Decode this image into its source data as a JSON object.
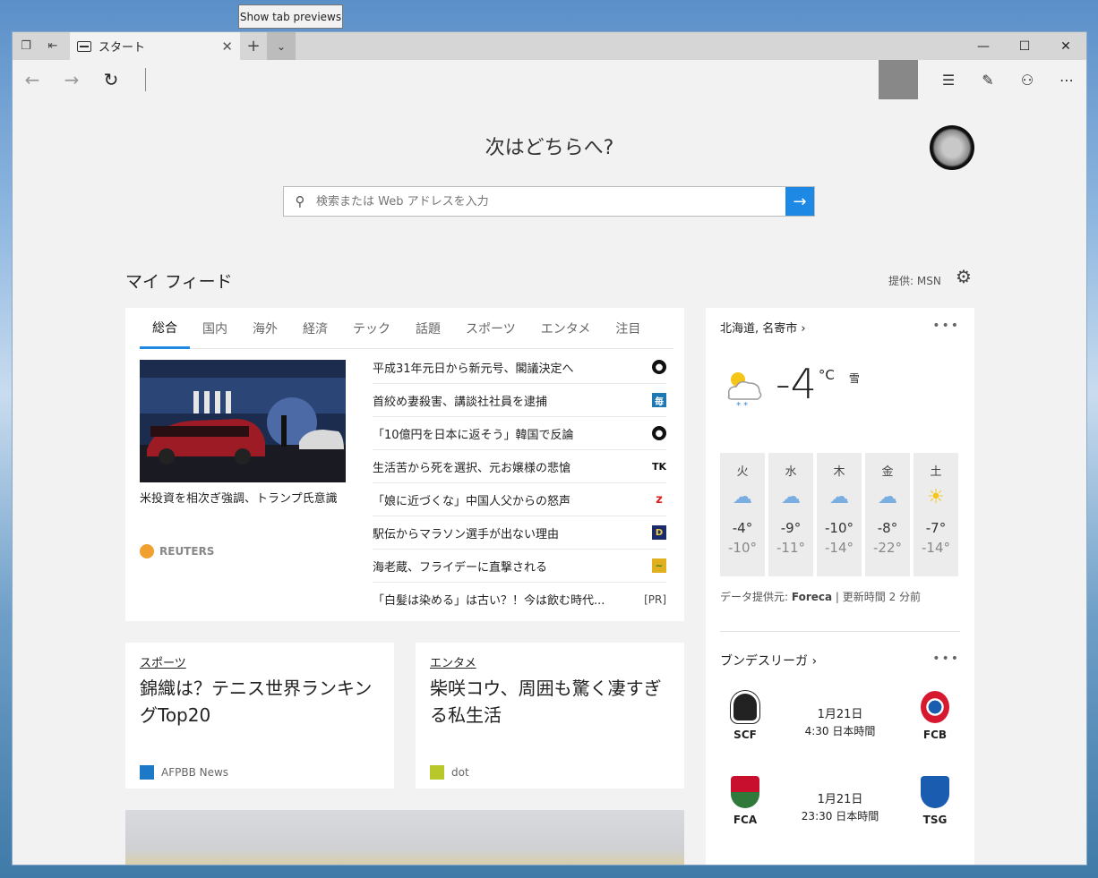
{
  "tooltip": "Show tab previews",
  "tab": {
    "title": "スタート"
  },
  "search": {
    "placeholder": "検索または Web アドレスを入力"
  },
  "heading": "次はどちらへ?",
  "feed": {
    "title": "マイ フィード",
    "provider": "提供: MSN",
    "tabs": [
      "総合",
      "国内",
      "海外",
      "経済",
      "テック",
      "話題",
      "スポーツ",
      "エンタメ",
      "注目"
    ],
    "hero": {
      "caption": "米投資を相次ぎ強調、トランプ氏意識",
      "source": "REUTERS"
    },
    "headlines": [
      {
        "text": "平成31年元日から新元号、閣議決定へ",
        "icon": "tbs-icon"
      },
      {
        "text": "首絞め妻殺害、講談社社員を逮捕",
        "icon": "mainichi-icon"
      },
      {
        "text": "「10億円を日本に返そう」韓国で反論",
        "icon": "tbs-icon"
      },
      {
        "text": "生活苦から死を選択、元お嬢様の悲愴",
        "icon": "tk-icon"
      },
      {
        "text": "「娘に近づくな」中国人父からの怒声",
        "icon": "zakzak-icon"
      },
      {
        "text": "駅伝からマラソン選手が出ない理由",
        "icon": "diamond-icon"
      },
      {
        "text": "海老蔵、フライデーに直撃される",
        "icon": "friday-icon"
      },
      {
        "text": "「白髪は染める」は古い？！今は飲む時代...",
        "badge": "[PR]"
      }
    ],
    "cards": [
      {
        "category": "スポーツ",
        "title": "錦織は？テニス世界ランキングTop20",
        "source": "AFPBB News"
      },
      {
        "category": "エンタメ",
        "title": "柴咲コウ、周囲も驚く凄すぎる私生活",
        "source": "dot"
      }
    ]
  },
  "weather": {
    "location": "北海道, 名寄市",
    "temp": "-4",
    "unit": "°C",
    "condition": "雪",
    "days": [
      {
        "name": "火",
        "hi": "-4°",
        "lo": "-10°",
        "icon": "☁"
      },
      {
        "name": "水",
        "hi": "-9°",
        "lo": "-11°",
        "icon": "☁"
      },
      {
        "name": "木",
        "hi": "-10°",
        "lo": "-14°",
        "icon": "☁"
      },
      {
        "name": "金",
        "hi": "-8°",
        "lo": "-22°",
        "icon": "☁"
      },
      {
        "name": "土",
        "hi": "-7°",
        "lo": "-14°",
        "icon": "☀"
      }
    ],
    "attribution_prefix": "データ提供元: ",
    "attribution_source": "Foreca",
    "attribution_suffix": " | 更新時間 2 分前"
  },
  "league": {
    "name": "ブンデスリーガ",
    "matches": [
      {
        "home": "SCF",
        "away": "FCB",
        "date": "1月21日",
        "time": "4:30 日本時間"
      },
      {
        "home": "FCA",
        "away": "TSG",
        "date": "1月21日",
        "time": "23:30 日本時間"
      }
    ]
  },
  "colors": {
    "accent": "#1e88e5",
    "feedBackground": "#f2f2f2"
  }
}
